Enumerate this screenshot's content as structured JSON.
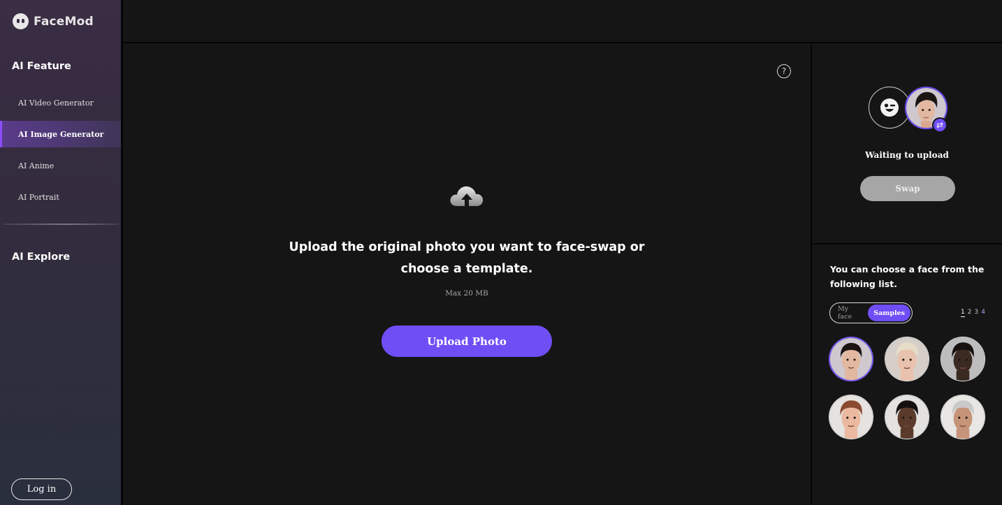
{
  "brand": {
    "name": "FaceMod"
  },
  "sidebar": {
    "section_feature": "AI Feature",
    "items": [
      {
        "label": "AI Video Generator",
        "active": false
      },
      {
        "label": "AI Image Generator",
        "active": true
      },
      {
        "label": "AI Anime",
        "active": false
      },
      {
        "label": "AI Portrait",
        "active": false
      }
    ],
    "section_explore": "AI Explore",
    "login_label": "Log in"
  },
  "main": {
    "help_symbol": "?",
    "heading_line1": "Upload the original photo you want to face-swap or",
    "heading_line2": "choose a template.",
    "max_size": "Max 20 MB",
    "upload_button": "Upload Photo",
    "upload_icon": "cloud-upload-icon"
  },
  "swap_panel": {
    "status": "Waiting to upload",
    "swap_button": "Swap",
    "swap_badge_symbol": "⇄"
  },
  "face_list": {
    "prompt": "You can choose a face from the following list.",
    "tabs": [
      {
        "label": "My face",
        "active": false
      },
      {
        "label": "Samples",
        "active": true
      }
    ],
    "pages": [
      "1",
      "2",
      "3",
      "4"
    ],
    "current_page": "1",
    "faces": [
      {
        "selected": true,
        "skin": "#e2b8a0",
        "hair": "#1c1412",
        "bg": "#cfc8cf"
      },
      {
        "selected": false,
        "skin": "#e8c2ac",
        "hair": "#e6dcc8",
        "bg": "#d6cfc9"
      },
      {
        "selected": false,
        "skin": "#3a2a22",
        "hair": "#171210",
        "bg": "#bdbdbd"
      },
      {
        "selected": false,
        "skin": "#eab9a0",
        "hair": "#8a4a2e",
        "bg": "#e6e2df"
      },
      {
        "selected": false,
        "skin": "#5a3a2a",
        "hair": "#141010",
        "bg": "#e4e2e0"
      },
      {
        "selected": false,
        "skin": "#c69478",
        "hair": "#c9c9c9",
        "bg": "#e9e7e4"
      }
    ]
  },
  "colors": {
    "accent": "#6f4ef6",
    "sidebar_active": "#8b4dff"
  }
}
